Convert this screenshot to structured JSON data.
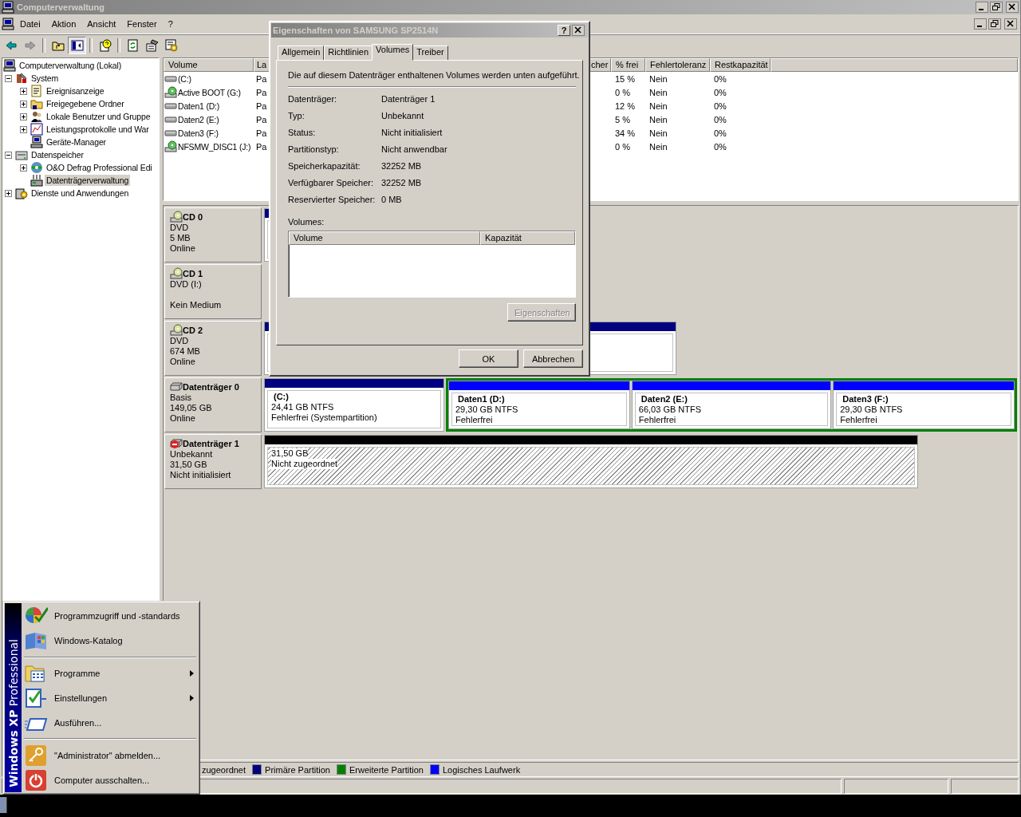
{
  "window": {
    "title": "Computerverwaltung"
  },
  "menu": [
    {
      "label": "Datei"
    },
    {
      "label": "Aktion"
    },
    {
      "label": "Ansicht"
    },
    {
      "label": "Fenster"
    },
    {
      "label": "?"
    }
  ],
  "toolbar": [
    {
      "pressed": false
    },
    {
      "pressed": false
    },
    {
      "pressed": false
    },
    {
      "pressed": true
    },
    {
      "pressed": false
    },
    {
      "pressed": false
    },
    {
      "pressed": false
    },
    {
      "pressed": false
    }
  ],
  "tree": [
    {
      "label": "Computerverwaltung (Lokal)",
      "selected": false,
      "children": [
        {
          "label": "System",
          "expanded": true,
          "selected": false,
          "children": [
            {
              "label": "Ereignisanzeige",
              "expanded": false,
              "selected": false
            },
            {
              "label": "Freigegebene Ordner",
              "expanded": false,
              "selected": false
            },
            {
              "label": "Lokale Benutzer und Gruppe",
              "expanded": false,
              "selected": false
            },
            {
              "label": "Leistungsprotokolle und War",
              "expanded": false,
              "selected": false
            },
            {
              "label": "Geräte-Manager",
              "selected": false
            }
          ]
        },
        {
          "label": "Datenspeicher",
          "expanded": true,
          "selected": false,
          "children": [
            {
              "label": "O&O Defrag Professional Edi",
              "expanded": false,
              "selected": false
            },
            {
              "label": "Datenträgerverwaltung",
              "selected": true
            }
          ]
        },
        {
          "label": "Dienste und Anwendungen",
          "expanded": false,
          "selected": false
        }
      ]
    }
  ],
  "volume_list": {
    "columns": [
      {
        "label": "Volume"
      },
      {
        "label": "La"
      },
      {
        "label": "cher"
      },
      {
        "label": "% frei"
      },
      {
        "label": "Fehlertoleranz"
      },
      {
        "label": "Restkapazität"
      }
    ],
    "rows": [
      {
        "kind": "disk",
        "volume": "(C:)",
        "column_2": "Pa",
        "percent_free": "15 %",
        "fault_tolerance": "Nein",
        "overhead": "0%"
      },
      {
        "kind": "cd",
        "volume": "Active BOOT (G:)",
        "column_2": "Pa",
        "percent_free": "0 %",
        "fault_tolerance": "Nein",
        "overhead": "0%"
      },
      {
        "kind": "disk",
        "volume": "Daten1 (D:)",
        "column_2": "Pa",
        "percent_free": "12 %",
        "fault_tolerance": "Nein",
        "overhead": "0%"
      },
      {
        "kind": "disk",
        "volume": "Daten2 (E:)",
        "column_2": "Pa",
        "percent_free": "5 %",
        "fault_tolerance": "Nein",
        "overhead": "0%"
      },
      {
        "kind": "disk",
        "volume": "Daten3 (F:)",
        "column_2": "Pa",
        "percent_free": "34 %",
        "fault_tolerance": "Nein",
        "overhead": "0%"
      },
      {
        "kind": "cd",
        "volume": "NFSMW_DISC1 (J:)",
        "column_2": "Pa",
        "percent_free": "0 %",
        "fault_tolerance": "Nein",
        "overhead": "0%"
      }
    ]
  },
  "disks": [
    {
      "kind": "cd",
      "name": "CD 0",
      "type": "DVD",
      "size": "5 MB",
      "status": "Online",
      "partitions": [
        {
          "kind": "primary"
        }
      ]
    },
    {
      "kind": "cd",
      "name": "CD 1",
      "type": "DVD (I:)",
      "status": "Kein Medium"
    },
    {
      "kind": "cd",
      "name": "CD 2",
      "type": "DVD",
      "size": "674 MB",
      "status": "Online",
      "partitions": [
        {
          "kind": "primary"
        }
      ]
    },
    {
      "kind": "disk",
      "error": false,
      "name": "Datenträger 0",
      "type": "Basis",
      "size": "149,05 GB",
      "status": "Online",
      "partitions": [
        {
          "kind": "primary",
          "title": "(C:)",
          "size": "24,41 GB NTFS",
          "status": "Fehlerfrei (Systempartition)"
        },
        {
          "kind": "extended",
          "children": [
            {
              "kind": "logical",
              "title": "Daten1  (D:)",
              "size": "29,30 GB NTFS",
              "status": "Fehlerfrei"
            },
            {
              "kind": "logical",
              "title": "Daten2  (E:)",
              "size": "66,03 GB NTFS",
              "status": "Fehlerfrei"
            },
            {
              "kind": "logical",
              "title": "Daten3  (F:)",
              "size": "29,30 GB NTFS",
              "status": "Fehlerfrei"
            }
          ]
        }
      ]
    },
    {
      "kind": "disk",
      "error": true,
      "name": "Datenträger 1",
      "type": "Unbekannt",
      "size": "31,50 GB",
      "status": "Nicht initialisiert",
      "partitions": [
        {
          "kind": "unallocated",
          "size": "31,50 GB",
          "status": "Nicht zugeordnet"
        }
      ]
    }
  ],
  "legend": [
    {
      "label": "zugeordnet"
    },
    {
      "label": "Primäre Partition",
      "color": "#000080"
    },
    {
      "label": "Erweiterte Partition",
      "color": "#008000"
    },
    {
      "label": "Logisches Laufwerk",
      "color": "#0000ff"
    }
  ],
  "dialog": {
    "title": "Eigenschaften von SAMSUNG SP2514N",
    "help": "?",
    "tabs": [
      {
        "label": "Allgemein",
        "selected": false
      },
      {
        "label": "Richtlinien",
        "selected": false
      },
      {
        "label": "Volumes",
        "selected": true
      },
      {
        "label": "Treiber",
        "selected": false
      }
    ],
    "intro": "Die auf diesem Datenträger enthaltenen Volumes werden unten aufgeführt.",
    "fields": [
      {
        "label": "Datenträger:",
        "value": "Datenträger 1"
      },
      {
        "label": "Typ:",
        "value": "Unbekannt"
      },
      {
        "label": "Status:",
        "value": "Nicht initialisiert"
      },
      {
        "label": "Partitionstyp:",
        "value": "Nicht anwendbar"
      },
      {
        "label": "Speicherkapazität:",
        "value": "32252 MB"
      },
      {
        "label": "Verfügbarer Speicher:",
        "value": "32252 MB"
      },
      {
        "label": "Reservierter Speicher:",
        "value": "0 MB"
      }
    ],
    "volumes_label": "Volumes:",
    "volumes_columns": [
      {
        "label": "Volume"
      },
      {
        "label": "Kapazität"
      }
    ],
    "properties_button": {
      "label": "Eigenschaften",
      "disabled": true
    },
    "buttons": [
      {
        "label": "OK"
      },
      {
        "label": "Abbrechen"
      }
    ]
  },
  "start_menu": {
    "banner": "**Windows XP** Professional",
    "groups": [
      {
        "items": [
          {
            "label": "Programmzugriff und -standards",
            "submenu": false
          },
          {
            "label": "Windows-Katalog",
            "submenu": false
          }
        ]
      },
      {
        "items": [
          {
            "label": "Programme",
            "submenu": true
          },
          {
            "label": "Einstellungen",
            "submenu": true
          },
          {
            "label": "Ausführen...",
            "submenu": false
          }
        ]
      },
      {
        "items": [
          {
            "label": "\"Administrator\" abmelden...",
            "submenu": false
          },
          {
            "label": "Computer ausschalten...",
            "submenu": false
          }
        ]
      }
    ]
  }
}
